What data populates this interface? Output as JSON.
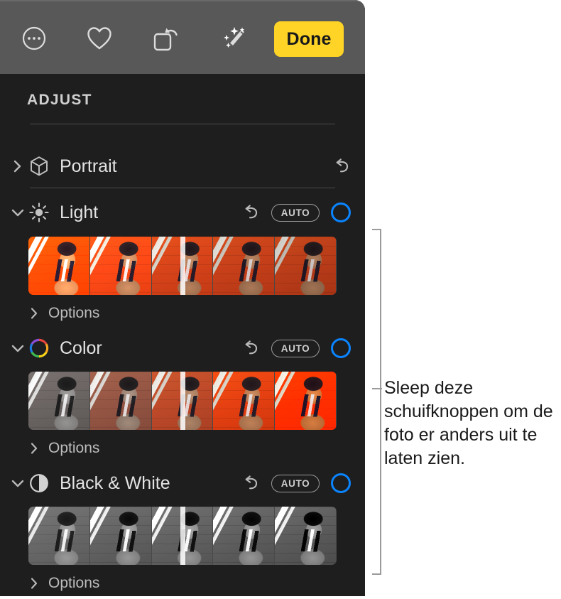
{
  "toolbar": {
    "more_label": "more-options",
    "favorite_label": "favorite",
    "rotate_label": "rotate",
    "enhance_label": "auto-enhance",
    "done_label": "Done",
    "done_color": "#FFD426"
  },
  "panel": {
    "section_title": "ADJUST",
    "accent_color": "#0a84ff",
    "background_color": "#1e1e1e",
    "adjustments": [
      {
        "label": "Portrait",
        "icon": "cube-icon",
        "expanded": false,
        "chevron": "chevron-right",
        "has_reset": true,
        "has_auto": false,
        "has_toggle": false,
        "has_slider": false
      },
      {
        "label": "Light",
        "icon": "sun-icon",
        "expanded": true,
        "chevron": "chevron-down",
        "has_reset": true,
        "has_auto": true,
        "auto_label": "AUTO",
        "has_toggle": true,
        "has_slider": true,
        "options_label": "Options",
        "slider_position": "50%"
      },
      {
        "label": "Color",
        "icon": "color-wheel-icon",
        "expanded": true,
        "chevron": "chevron-down",
        "has_reset": true,
        "has_auto": true,
        "auto_label": "AUTO",
        "has_toggle": true,
        "has_slider": true,
        "options_label": "Options",
        "slider_position": "50%"
      },
      {
        "label": "Black & White",
        "icon": "contrast-circle-icon",
        "expanded": true,
        "chevron": "chevron-down",
        "has_reset": true,
        "has_auto": true,
        "auto_label": "AUTO",
        "has_toggle": true,
        "has_slider": true,
        "options_label": "Options",
        "slider_position": "50%"
      }
    ]
  },
  "callout": {
    "text": "Sleep deze schuifknoppen om de foto er anders uit te laten zien.",
    "line_color": "#9b9b9b"
  }
}
